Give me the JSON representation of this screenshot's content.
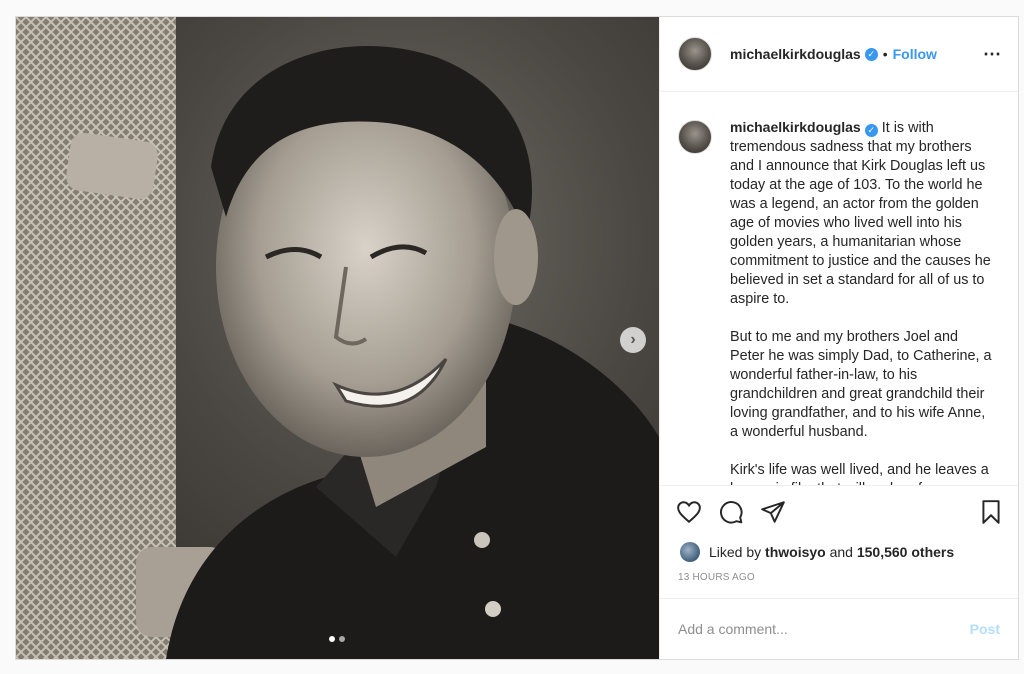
{
  "post": {
    "username": "michaelkirkdouglas",
    "follow_label": "Follow",
    "separator": "•",
    "more_icon": "⋯",
    "caption_paragraphs": [
      "It is with tremendous sadness that my brothers and I announce that Kirk Douglas left us today at the age of 103. To the world he was a legend, an actor from the golden age of movies who lived well into his golden years, a humanitarian whose commitment to justice and the causes he believed in set a standard for all of us to aspire to.",
      "But to me and my brothers Joel and Peter he was simply Dad, to Catherine, a wonderful father-in-law, to his grandchildren and great grandchild their loving grandfather, and to his wife Anne, a wonderful husband.",
      "Kirk's life was well lived, and he leaves a legacy in film that will endure for"
    ],
    "likes": {
      "prefix": "Liked by",
      "user": "thwoisyo",
      "connector": "and",
      "count": "150,560 others"
    },
    "timestamp": "13 HOURS AGO",
    "comment_placeholder": "Add a comment...",
    "post_label": "Post",
    "carousel": {
      "total": 2,
      "active": 1,
      "next_icon": "›"
    },
    "colors": {
      "accent": "#3897f0",
      "post_disabled": "#b2dffc",
      "muted": "#8e8e8e"
    }
  }
}
